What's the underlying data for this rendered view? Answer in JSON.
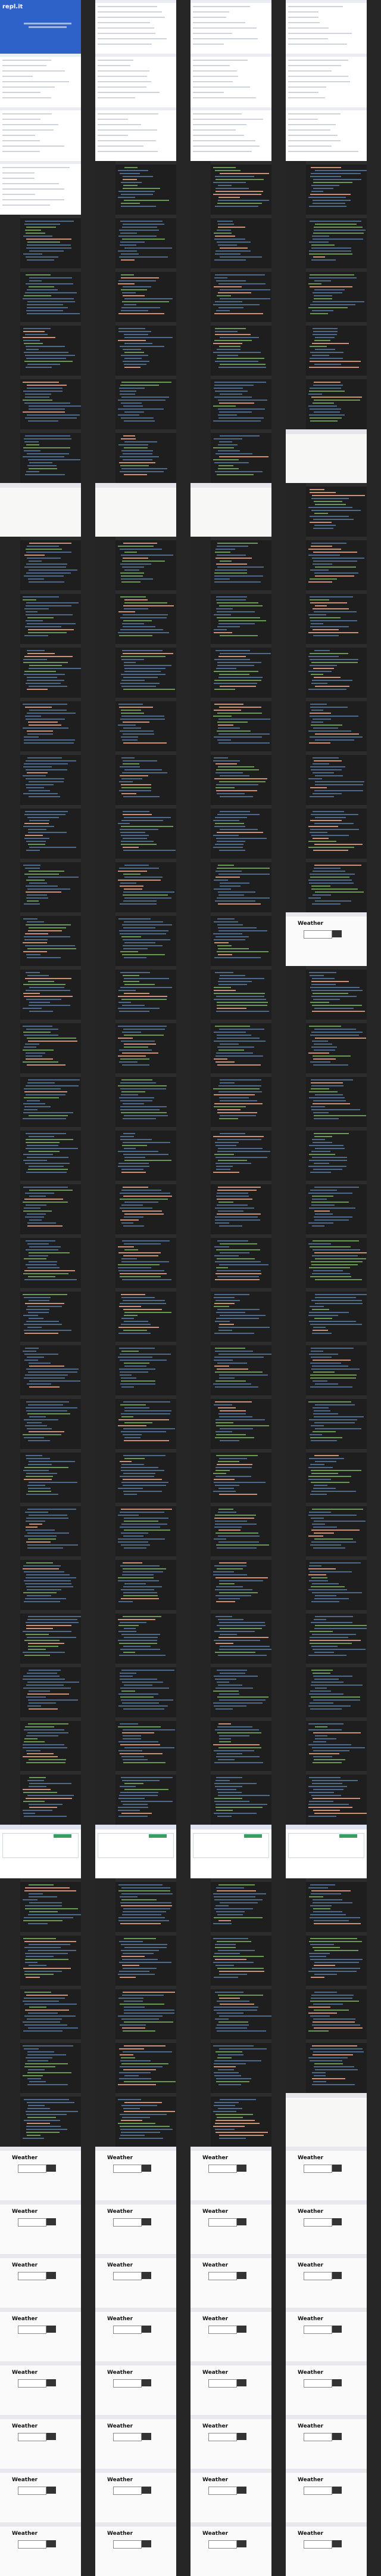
{
  "splash": {
    "logo": "repl.it"
  },
  "weather": {
    "title": "Weather"
  },
  "frames": [
    "splash",
    "doc",
    "doc",
    "doc",
    "doc",
    "doc",
    "doc",
    "doc",
    "doc",
    "doc",
    "doc",
    "doc",
    "doc",
    "ide",
    "ide",
    "ide",
    "ide",
    "ide",
    "ide",
    "ide",
    "ide",
    "ide",
    "ide",
    "ide",
    "ide",
    "ide",
    "ide",
    "ide",
    "ide",
    "ide",
    "ide",
    "ide",
    "ide",
    "ide",
    "ide",
    "blank",
    "blank",
    "blank",
    "blank",
    "ide",
    "ide",
    "ide",
    "ide",
    "ide",
    "ide",
    "ide",
    "ide",
    "ide",
    "ide",
    "ide",
    "ide",
    "ide",
    "ide",
    "ide",
    "ide",
    "ide",
    "ide",
    "ide",
    "ide",
    "ide",
    "ide",
    "ide",
    "ide",
    "ide",
    "ide",
    "ide",
    "ide",
    "ide",
    "ide",
    "ide",
    "ide",
    "weather",
    "ide",
    "ide",
    "ide",
    "ide",
    "ide",
    "ide",
    "ide",
    "ide",
    "ide",
    "ide",
    "ide",
    "ide",
    "ide",
    "ide",
    "ide",
    "ide",
    "ide",
    "ide",
    "ide",
    "ide",
    "ide",
    "ide",
    "ide",
    "ide",
    "ide",
    "ide",
    "ide",
    "ide",
    "ide",
    "ide",
    "ide",
    "ide",
    "ide",
    "ide",
    "ide",
    "ide",
    "ide",
    "ide",
    "ide",
    "ide",
    "ide",
    "ide",
    "ide",
    "ide",
    "ide",
    "ide",
    "ide",
    "ide",
    "ide",
    "ide",
    "ide",
    "ide",
    "ide",
    "ide",
    "ide",
    "ide",
    "ide",
    "ide",
    "ide",
    "ide",
    "ide",
    "ide",
    "ide",
    "ide",
    "browser",
    "browser",
    "browser",
    "browser",
    "ide",
    "ide",
    "ide",
    "ide",
    "ide",
    "ide",
    "ide",
    "ide",
    "ide",
    "ide",
    "ide",
    "ide",
    "ide",
    "ide",
    "ide",
    "ide",
    "ide",
    "ide",
    "ide",
    "blank",
    "weather",
    "weather",
    "weather",
    "weather",
    "weather",
    "weather",
    "weather",
    "weather",
    "weather",
    "weather",
    "weather",
    "weather",
    "weather",
    "weather",
    "weather",
    "weather",
    "weather",
    "weather",
    "weather",
    "weather",
    "weather",
    "weather",
    "weather",
    "weather",
    "weather",
    "weather",
    "weather",
    "weather",
    "weather",
    "weather",
    "weather",
    "weather"
  ],
  "colors": {
    "splash": "#2f62c9",
    "ide_bg": "#1e1e1e",
    "doc_bg": "#ffffff"
  }
}
